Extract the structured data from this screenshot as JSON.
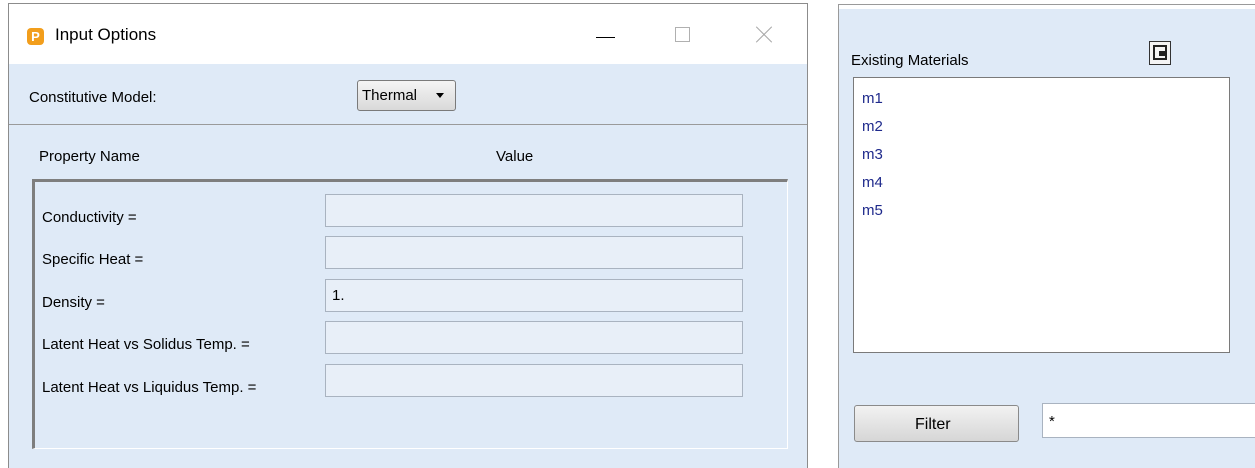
{
  "input_options": {
    "window_title": "Input Options",
    "app_icon_letter": "P",
    "constitutive_model_label": "Constitutive Model:",
    "constitutive_model_value": "Thermal",
    "header_property": "Property Name",
    "header_value": "Value",
    "properties": [
      {
        "label": "Conductivity =",
        "value": ""
      },
      {
        "label": "Specific Heat =",
        "value": ""
      },
      {
        "label": "Density =",
        "value": "1."
      },
      {
        "label": "Latent Heat vs Solidus Temp. =",
        "value": ""
      },
      {
        "label": "Latent Heat vs Liquidus Temp. =",
        "value": ""
      }
    ]
  },
  "materials_panel": {
    "title": "Existing Materials",
    "items": [
      "m1",
      "m2",
      "m3",
      "m4",
      "m5"
    ],
    "filter_button": "Filter",
    "filter_value": "*"
  },
  "colors": {
    "panel_bg": "#dfeaf7",
    "list_text": "#1f2a8c",
    "app_icon": "#f29e1c"
  }
}
